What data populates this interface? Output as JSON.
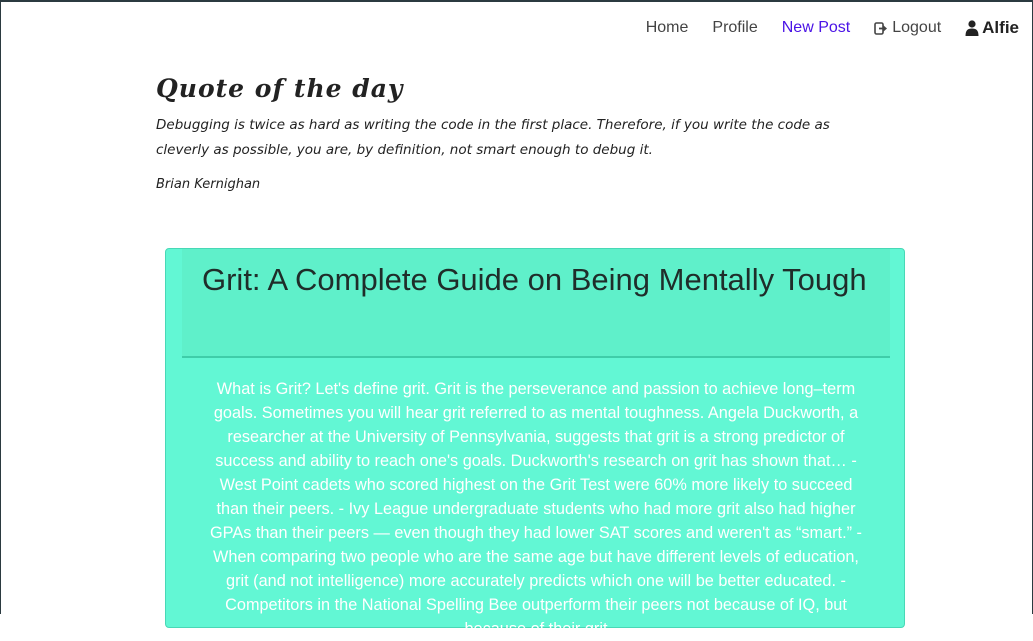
{
  "nav": {
    "home": "Home",
    "profile": "Profile",
    "new_post": "New Post",
    "logout": "Logout",
    "user": "Alfie",
    "active_color": "#4b14e6"
  },
  "quote": {
    "heading": "Quote of the day",
    "text": "Debugging is twice as hard as writing the code in the first place. Therefore, if you write the code as cleverly as possible, you are, by definition, not smart enough to debug it.",
    "author": "Brian Kernighan"
  },
  "post": {
    "title": "Grit: A Complete Guide on Being Mentally Tough",
    "body": "What is Grit? Let's define grit. Grit is the perseverance and passion to achieve long–term goals. Sometimes you will hear grit referred to as mental toughness. Angela Duckworth, a researcher at the University of Pennsylvania, suggests that grit is a strong predictor of success and ability to reach one's goals. Duckworth's research on grit has shown that… - West Point cadets who scored highest on the Grit Test were 60% more likely to succeed than their peers. - Ivy League undergraduate students who had more grit also had higher GPAs than their peers — even though they had lower SAT scores and weren't as “smart.” - When comparing two people who are the same age but have different levels of education, grit (and not intelligence) more accurately predicts which one will be better educated. - Competitors in the National Spelling Bee outperform their peers not because of IQ, but because of their grit",
    "card_color": "#62f7d4"
  }
}
